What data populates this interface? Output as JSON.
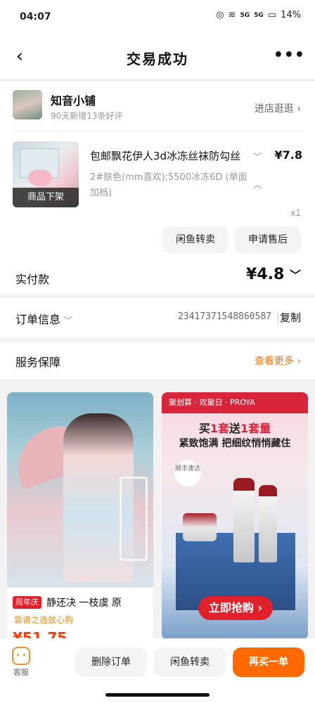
{
  "status": {
    "time": "04:07",
    "battery": "14%",
    "net1": "5G",
    "net2": "5G"
  },
  "nav": {
    "title": "交易成功"
  },
  "shop": {
    "name": "知音小铺",
    "subtitle": "90天新增13条好评",
    "link": "进店逛逛"
  },
  "goods": {
    "title": "包邮飘花伊人3d冰冻丝袜防勾丝",
    "spec": "2#肤色(mm喜欢);5500冰冻6D (单面加档)",
    "price": "¥7.8",
    "quantity": "x1",
    "tag": "商品下架"
  },
  "actions": {
    "resell": "闲鱼转卖",
    "aftersale": "申请售后"
  },
  "payment": {
    "label": "实付款",
    "amount": "¥4.8"
  },
  "order": {
    "label": "订单信息",
    "number": "2341737154886058​7",
    "copy": "复制"
  },
  "service": {
    "label": "服务保障",
    "more": "查看更多"
  },
  "feed": {
    "a": {
      "badge": "周年庆",
      "title": "静还决 一枝虞 原",
      "subtitle": "靠谱之选放心购",
      "price": "¥51.75"
    },
    "b": {
      "topbar": "聚划算 · 欢聚日 · PROYA",
      "headline_pre": "买",
      "headline_red1": "1套",
      "headline_mid": "送",
      "headline_red2": "1套量",
      "subtitle": "紧致饱满 把细纹悄悄藏住",
      "sf": "顺丰速达",
      "cta": "立即抢购"
    }
  },
  "bottom": {
    "cs": "客服",
    "delete": "删除订单",
    "resell": "闲鱼转卖",
    "rebuy": "再买一单"
  }
}
